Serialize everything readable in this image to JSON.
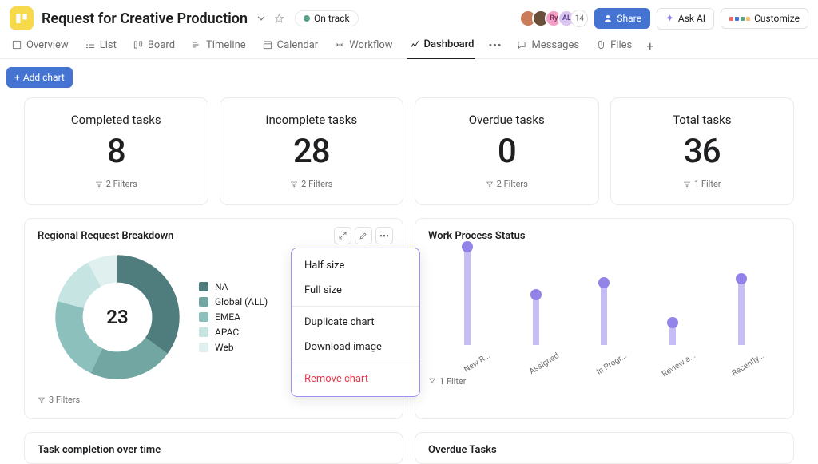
{
  "header": {
    "title": "Request for Creative Production",
    "status": "On track",
    "avatars": {
      "a3": "Ry",
      "a4": "AL",
      "more": "14"
    },
    "share": "Share",
    "ask_ai": "Ask AI",
    "customize": "Customize"
  },
  "tabs": {
    "overview": "Overview",
    "list": "List",
    "board": "Board",
    "timeline": "Timeline",
    "calendar": "Calendar",
    "workflow": "Workflow",
    "dashboard": "Dashboard",
    "messages": "Messages",
    "files": "Files",
    "more": "•••",
    "add": "+"
  },
  "toolbar": {
    "add_chart": "Add chart"
  },
  "stats": {
    "completed": {
      "title": "Completed tasks",
      "value": "8",
      "filters": "2 Filters"
    },
    "incomplete": {
      "title": "Incomplete tasks",
      "value": "28",
      "filters": "2 Filters"
    },
    "overdue": {
      "title": "Overdue tasks",
      "value": "0",
      "filters": "2 Filters"
    },
    "total": {
      "title": "Total tasks",
      "value": "36",
      "filters": "1 Filter"
    }
  },
  "donut": {
    "title": "Regional Request Breakdown",
    "center": "23",
    "filters": "3 Filters",
    "legend": {
      "na": "NA",
      "global": "Global (ALL)",
      "emea": "EMEA",
      "apac": "APAC",
      "web": "Web"
    },
    "menu": {
      "half": "Half size",
      "full": "Full size",
      "dup": "Duplicate chart",
      "dl": "Download image",
      "remove": "Remove chart"
    }
  },
  "lollipop": {
    "title": "Work Process Status",
    "filters": "1 Filter",
    "labels": {
      "c0": "New R...",
      "c1": "Assigned",
      "c2": "In Progr...",
      "c3": "Review a...",
      "c4": "Recently..."
    }
  },
  "row3": {
    "completion": "Task completion over time",
    "overdue": "Overdue Tasks"
  },
  "chart_data": [
    {
      "type": "bar",
      "title": "Completed tasks",
      "values": [
        8
      ]
    },
    {
      "type": "pie",
      "title": "Regional Request Breakdown",
      "categories": [
        "NA",
        "Global (ALL)",
        "EMEA",
        "APAC",
        "Web"
      ],
      "values": [
        8,
        5,
        5,
        3,
        2
      ],
      "total_label": 23,
      "colors": [
        "#4f7d7d",
        "#72a6a3",
        "#8cc0bd",
        "#c5e4e2",
        "#e0f0ef"
      ]
    },
    {
      "type": "bar",
      "title": "Work Process Status",
      "categories": [
        "New R...",
        "Assigned",
        "In Progr...",
        "Review a...",
        "Recently..."
      ],
      "values": [
        10,
        6,
        7,
        3,
        7
      ],
      "ylim": [
        0,
        10
      ]
    }
  ]
}
